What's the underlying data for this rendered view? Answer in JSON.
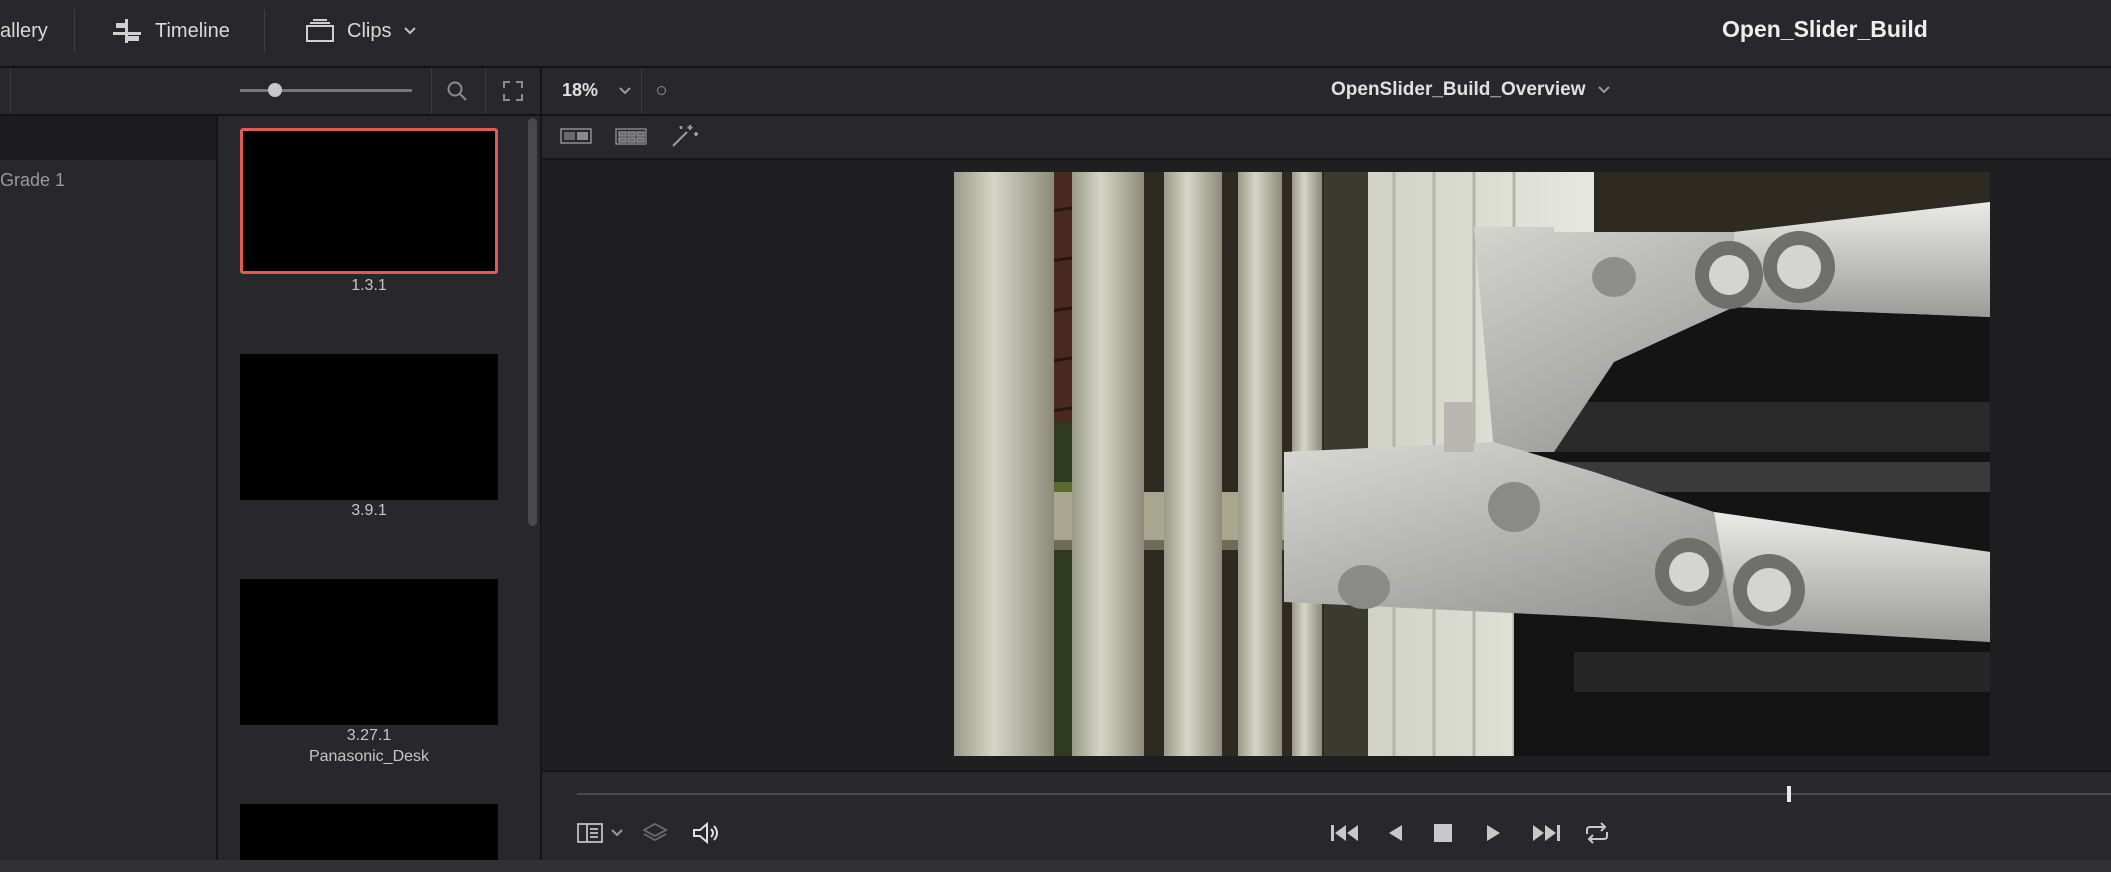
{
  "topbar": {
    "gallery_label": "allery",
    "timeline_label": "Timeline",
    "clips_label": "Clips",
    "project_title": "Open_Slider_Build"
  },
  "subbar": {
    "zoom_value": "18%",
    "timeline_name": "OpenSlider_Build_Overview"
  },
  "left_panel": {
    "items": [
      {
        "label": "Grade 1"
      }
    ]
  },
  "thumbnails": [
    {
      "label": "1.3.1",
      "sublabel": "",
      "selected": true
    },
    {
      "label": "3.9.1",
      "sublabel": "",
      "selected": false
    },
    {
      "label": "3.27.1",
      "sublabel": "Panasonic_Desk",
      "selected": false
    },
    {
      "label": "",
      "sublabel": "",
      "selected": false
    }
  ],
  "playhead": {
    "position": 0.79
  },
  "colors": {
    "accent_selected": "#e25b50",
    "panel": "#28282c",
    "background": "#1f1f22"
  }
}
